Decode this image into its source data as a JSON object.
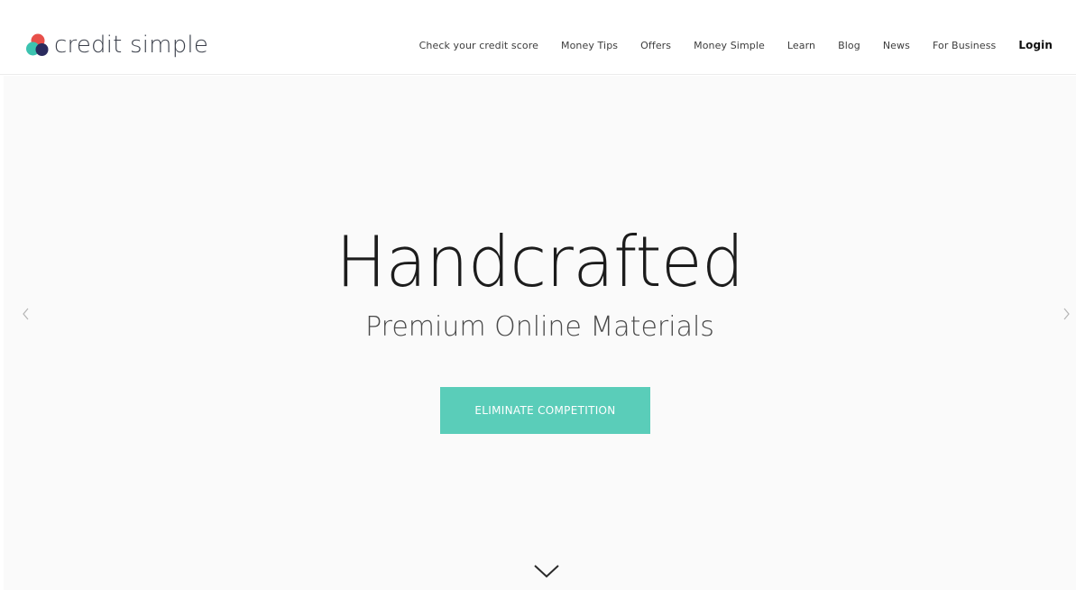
{
  "brand": {
    "name": "credit simple",
    "logo_icon": "overlapping-circles-logo-icon",
    "logo_colors": [
      "#e8504a",
      "#3cc3b0",
      "#2a2b5e"
    ]
  },
  "nav": {
    "items": [
      {
        "label": "Check your credit score"
      },
      {
        "label": "Money Tips"
      },
      {
        "label": "Offers"
      },
      {
        "label": "Money Simple"
      },
      {
        "label": "Learn"
      },
      {
        "label": "Blog"
      },
      {
        "label": "News"
      },
      {
        "label": "For Business"
      }
    ],
    "login_label": "Login"
  },
  "hero": {
    "title": "Handcrafted",
    "subtitle": "Premium Online Materials",
    "cta_label": "ELIMINATE COMPETITION",
    "cta_color": "#5acdb9",
    "prev_icon": "chevron-left-icon",
    "next_icon": "chevron-right-icon",
    "scroll_icon": "chevron-down-icon"
  }
}
